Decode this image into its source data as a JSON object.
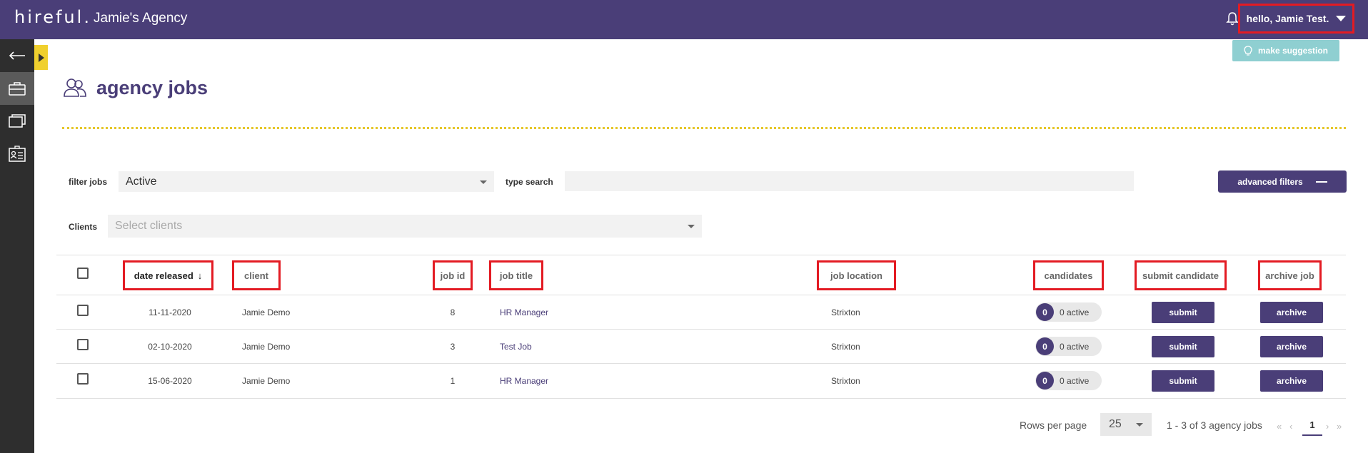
{
  "header": {
    "logo": "hireful.",
    "agency_name": "Jamie's Agency",
    "greeting": "hello, Jamie Test."
  },
  "make_suggestion": "make suggestion",
  "page_title": "agency jobs",
  "filters": {
    "filter_jobs_label": "filter jobs",
    "filter_jobs_value": "Active",
    "type_search_label": "type search",
    "search_value": "",
    "advanced_filters": "advanced filters",
    "clients_label": "Clients",
    "clients_placeholder": "Select clients"
  },
  "table": {
    "headers": {
      "date_released": "date released",
      "client": "client",
      "job_id": "job id",
      "job_title": "job title",
      "job_location": "job location",
      "candidates": "candidates",
      "submit_candidate": "submit candidate",
      "archive_job": "archive job"
    },
    "sort_indicator": "↓",
    "rows": [
      {
        "date": "11-11-2020",
        "client": "Jamie Demo",
        "id": "8",
        "title": "HR Manager",
        "location": "Strixton",
        "count": "0",
        "active": "0 active",
        "submit": "submit",
        "archive": "archive"
      },
      {
        "date": "02-10-2020",
        "client": "Jamie Demo",
        "id": "3",
        "title": "Test Job",
        "location": "Strixton",
        "count": "0",
        "active": "0 active",
        "submit": "submit",
        "archive": "archive"
      },
      {
        "date": "15-06-2020",
        "client": "Jamie Demo",
        "id": "1",
        "title": "HR Manager",
        "location": "Strixton",
        "count": "0",
        "active": "0 active",
        "submit": "submit",
        "archive": "archive"
      }
    ]
  },
  "pagination": {
    "rows_per_page_label": "Rows per page",
    "rows_per_page_value": "25",
    "range": "1 - 3 of 3 agency jobs",
    "current_page": "1",
    "first": "«",
    "prev": "‹",
    "next": "›",
    "last": "»"
  },
  "colors": {
    "brand_purple": "#4a3e78",
    "accent_yellow": "#f0d02e",
    "highlight_red": "#e31b23",
    "suggest_teal": "#8fcfd1"
  }
}
